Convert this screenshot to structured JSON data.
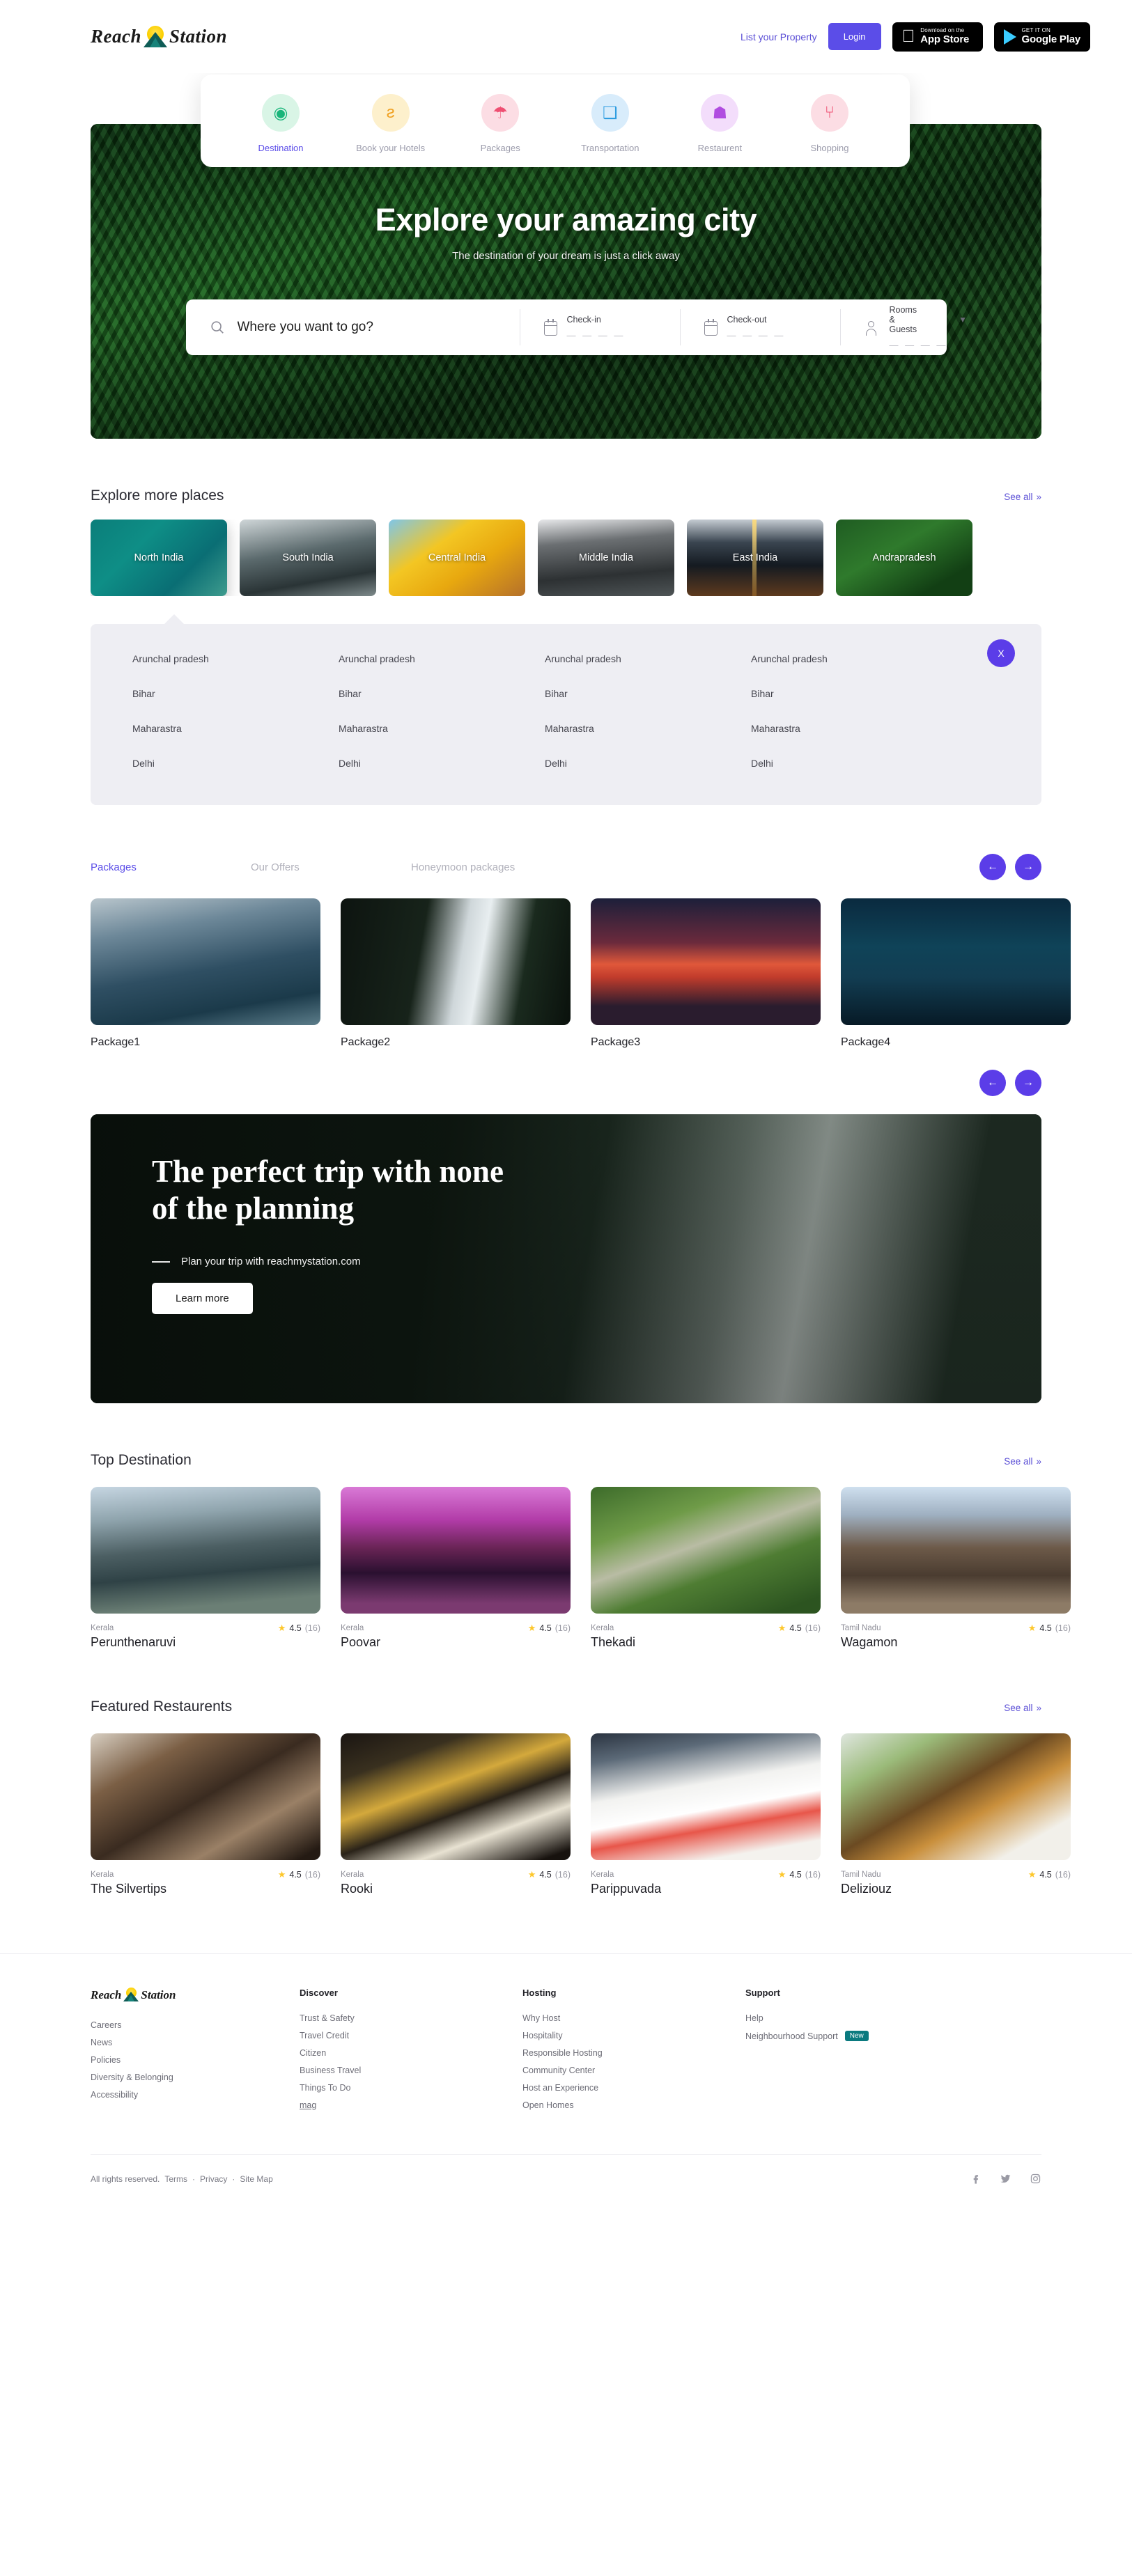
{
  "header": {
    "brand": "Reach Station",
    "list_property": "List your Property",
    "login": "Login",
    "appstore": {
      "small": "Download on the",
      "big": "App Store"
    },
    "googleplay": {
      "small": "GET IT ON",
      "big": "Google Play"
    }
  },
  "categories": [
    {
      "label": "Destination",
      "icon": "map-pin-icon",
      "glyph": "◉",
      "bg": "#d9f5e6",
      "color": "#19b57a",
      "active": true
    },
    {
      "label": "Book your  Hotels",
      "icon": "cutlery-icon",
      "glyph": "ƨ",
      "bg": "#fdf0cc",
      "color": "#f0a020",
      "active": false
    },
    {
      "label": "Packages",
      "icon": "beach-umbrella-icon",
      "glyph": "☂",
      "bg": "#fcdde4",
      "color": "#ef4f72",
      "active": false
    },
    {
      "label": "Transportation",
      "icon": "suitcase-icon",
      "glyph": "❑",
      "bg": "#d8ecfb",
      "color": "#2f9de0",
      "active": false
    },
    {
      "label": "Restaurent",
      "icon": "room-service-icon",
      "glyph": "☗",
      "bg": "#f3ddfb",
      "color": "#b04ce0",
      "active": false
    },
    {
      "label": "Shopping",
      "icon": "shopping-bag-icon",
      "glyph": "⑂",
      "bg": "#fcdde4",
      "color": "#ef4f72",
      "active": false
    }
  ],
  "hero": {
    "title": "Explore your amazing city",
    "subtitle": "The destination of your dream is just a click away",
    "search_placeholder": "Where you want to go?",
    "search_value": "",
    "checkin_label": "Check-in",
    "checkin_value": "— — — —",
    "checkout_label": "Check-out",
    "checkout_value": "— — — —",
    "rooms_label": "Rooms & Guests",
    "rooms_value": "— — — —"
  },
  "explore": {
    "title": "Explore more places",
    "see_all": "See all",
    "regions": [
      {
        "label": "North India",
        "active": true
      },
      {
        "label": "South India",
        "active": false
      },
      {
        "label": "Central India",
        "active": false
      },
      {
        "label": "Middle India",
        "active": false
      },
      {
        "label": "East India",
        "active": false
      },
      {
        "label": "Andrapradesh",
        "active": false
      }
    ],
    "state_columns": [
      [
        "Arunchal pradesh",
        "Bihar",
        "Maharastra",
        "Delhi"
      ],
      [
        "Arunchal pradesh",
        "Bihar",
        "Maharastra",
        "Delhi"
      ],
      [
        "Arunchal pradesh",
        "Bihar",
        "Maharastra",
        "Delhi"
      ],
      [
        "Arunchal pradesh",
        "Bihar",
        "Maharastra",
        "Delhi"
      ]
    ],
    "close_label": "X"
  },
  "packages": {
    "tabs": [
      {
        "label": "Packages",
        "active": true
      },
      {
        "label": "Our Offers",
        "active": false
      },
      {
        "label": "Honeymoon packages",
        "active": false
      }
    ],
    "prev": "←",
    "next": "→",
    "cards": [
      {
        "name": "Package1"
      },
      {
        "name": "Package2"
      },
      {
        "name": "Package3"
      },
      {
        "name": "Package4"
      }
    ]
  },
  "promo": {
    "title": "The perfect trip with none of the planning",
    "subtitle": "Plan your trip with reachmystation.com",
    "button": "Learn more"
  },
  "top_destination": {
    "title": "Top Destination",
    "see_all": "See all",
    "cards": [
      {
        "place": "Kerala",
        "name": "Perunthenaruvi",
        "rating": "4.5",
        "count": "(16)"
      },
      {
        "place": "Kerala",
        "name": "Poovar",
        "rating": "4.5",
        "count": "(16)"
      },
      {
        "place": "Kerala",
        "name": "Thekadi",
        "rating": "4.5",
        "count": "(16)"
      },
      {
        "place": "Tamil Nadu",
        "name": "Wagamon",
        "rating": "4.5",
        "count": "(16)"
      }
    ]
  },
  "featured_restaurants": {
    "title": "Featured Restaurents",
    "see_all": "See all",
    "cards": [
      {
        "place": "Kerala",
        "name": "The Silvertips",
        "rating": "4.5",
        "count": "(16)"
      },
      {
        "place": "Kerala",
        "name": "Rooki",
        "rating": "4.5",
        "count": "(16)"
      },
      {
        "place": "Kerala",
        "name": "Parippuvada",
        "rating": "4.5",
        "count": "(16)"
      },
      {
        "place": "Tamil Nadu",
        "name": "Deliziouz",
        "rating": "4.5",
        "count": "(16)"
      }
    ]
  },
  "footer": {
    "brand": "Reach Station",
    "brand_links": [
      "Careers",
      "News",
      "Policies",
      "Diversity & Belonging",
      "Accessibility"
    ],
    "columns": [
      {
        "head": "Discover",
        "links": [
          {
            "label": "Trust & Safety"
          },
          {
            "label": "Travel Credit"
          },
          {
            "label": "Citizen"
          },
          {
            "label": "Business Travel"
          },
          {
            "label": "Things To Do"
          },
          {
            "label": "mag",
            "underline": true
          }
        ]
      },
      {
        "head": "Hosting",
        "links": [
          {
            "label": "Why Host"
          },
          {
            "label": "Hospitality"
          },
          {
            "label": "Responsible Hosting"
          },
          {
            "label": "Community Center"
          },
          {
            "label": "Host an Experience"
          },
          {
            "label": "Open Homes"
          }
        ]
      },
      {
        "head": "Support",
        "links": [
          {
            "label": "Help"
          },
          {
            "label": "Neighbourhood Support",
            "badge": "New"
          }
        ]
      }
    ],
    "copyright": "All rights reserved.",
    "terms": "Terms",
    "privacy": "Privacy",
    "sitemap": "Site Map",
    "sep": "·",
    "social": [
      "facebook-icon",
      "twitter-icon",
      "instagram-icon"
    ]
  },
  "colors": {
    "accent": "#5b4de8",
    "accent_dark": "#5b3de8",
    "star": "#fdc72b",
    "badge_new": "#0b7a7f",
    "panel_bg": "#eeeef3"
  }
}
